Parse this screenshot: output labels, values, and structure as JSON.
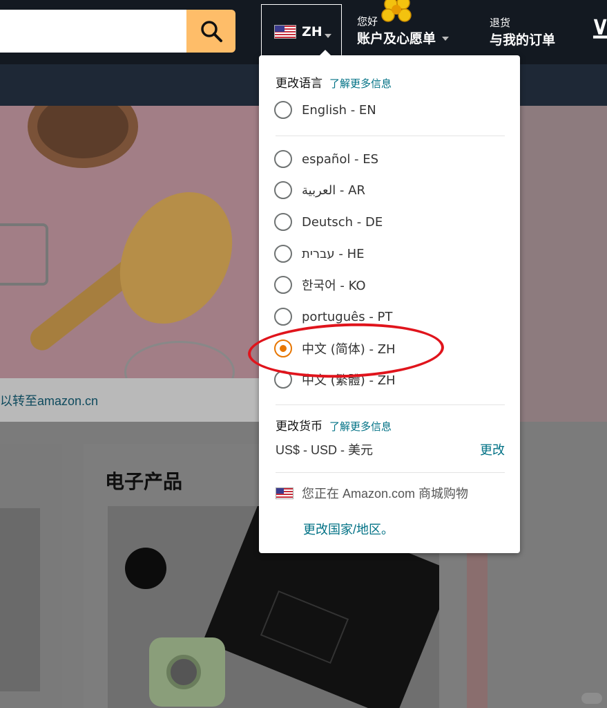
{
  "header": {
    "search_placeholder": "",
    "lang_code": "ZH",
    "account_small": "您好",
    "account_big": "账户及心愿单",
    "returns_small": "退货",
    "returns_big": "与我的订单"
  },
  "background": {
    "hero_caption": "以转至amazon.cn",
    "card_title": "电子产品"
  },
  "language_menu": {
    "title": "更改语言",
    "learn_more": "了解更多信息",
    "options": [
      {
        "label": "English - EN",
        "selected": false
      },
      {
        "label": "español - ES",
        "selected": false
      },
      {
        "label": "العربية - AR",
        "selected": false
      },
      {
        "label": "Deutsch - DE",
        "selected": false
      },
      {
        "label": "עברית - HE",
        "selected": false
      },
      {
        "label": "한국어 - KO",
        "selected": false
      },
      {
        "label": "português - PT",
        "selected": false
      },
      {
        "label": "中文 (简体) - ZH",
        "selected": true
      },
      {
        "label": "中文 (繁體) - ZH",
        "selected": false
      }
    ],
    "currency_title": "更改货币",
    "currency_learn_more": "了解更多信息",
    "currency_value": "US$ - USD - 美元",
    "currency_change": "更改",
    "shopping_at": "您正在 Amazon.com 商城购物",
    "change_region": "更改国家/地区。"
  },
  "colors": {
    "header_bg": "#131921",
    "accent": "#febd69",
    "link": "#007185",
    "radio_selected": "#e77600",
    "annotation": "#e0141c"
  }
}
